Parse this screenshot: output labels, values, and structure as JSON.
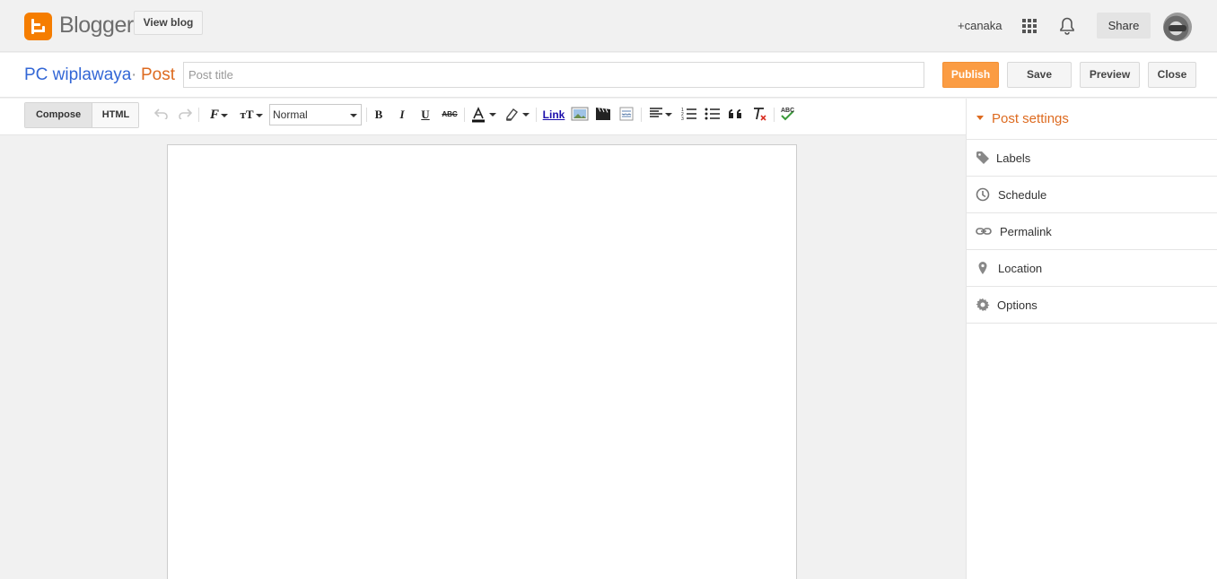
{
  "header": {
    "brand": "Blogger",
    "view_blog_label": "View blog",
    "user_link": "+canaka",
    "share_label": "Share"
  },
  "titlebar": {
    "blog_name": "PC wiplawaya",
    "separator": "·",
    "section": "Post",
    "title_placeholder": "Post title",
    "title_value": "",
    "publish_label": "Publish",
    "save_label": "Save",
    "preview_label": "Preview",
    "close_label": "Close"
  },
  "toolbar": {
    "compose_label": "Compose",
    "html_label": "HTML",
    "font_glyph": "F",
    "size_glyph": "тT",
    "format_value": "Normal",
    "bold_glyph": "B",
    "italic_glyph": "I",
    "underline_glyph": "U",
    "strike_glyph": "ABC",
    "link_label": "Link",
    "spell_glyph": "ABC"
  },
  "sidebar": {
    "heading": "Post settings",
    "items": [
      {
        "label": "Labels",
        "icon": "tag-icon"
      },
      {
        "label": "Schedule",
        "icon": "clock-icon"
      },
      {
        "label": "Permalink",
        "icon": "link-icon"
      },
      {
        "label": "Location",
        "icon": "pin-icon"
      },
      {
        "label": "Options",
        "icon": "gear-icon"
      }
    ]
  },
  "colors": {
    "accent_orange": "#dd6a1f",
    "publish_bg": "#fb9c43",
    "blog_name_blue": "#3367d6",
    "logo_orange": "#f57d00"
  }
}
